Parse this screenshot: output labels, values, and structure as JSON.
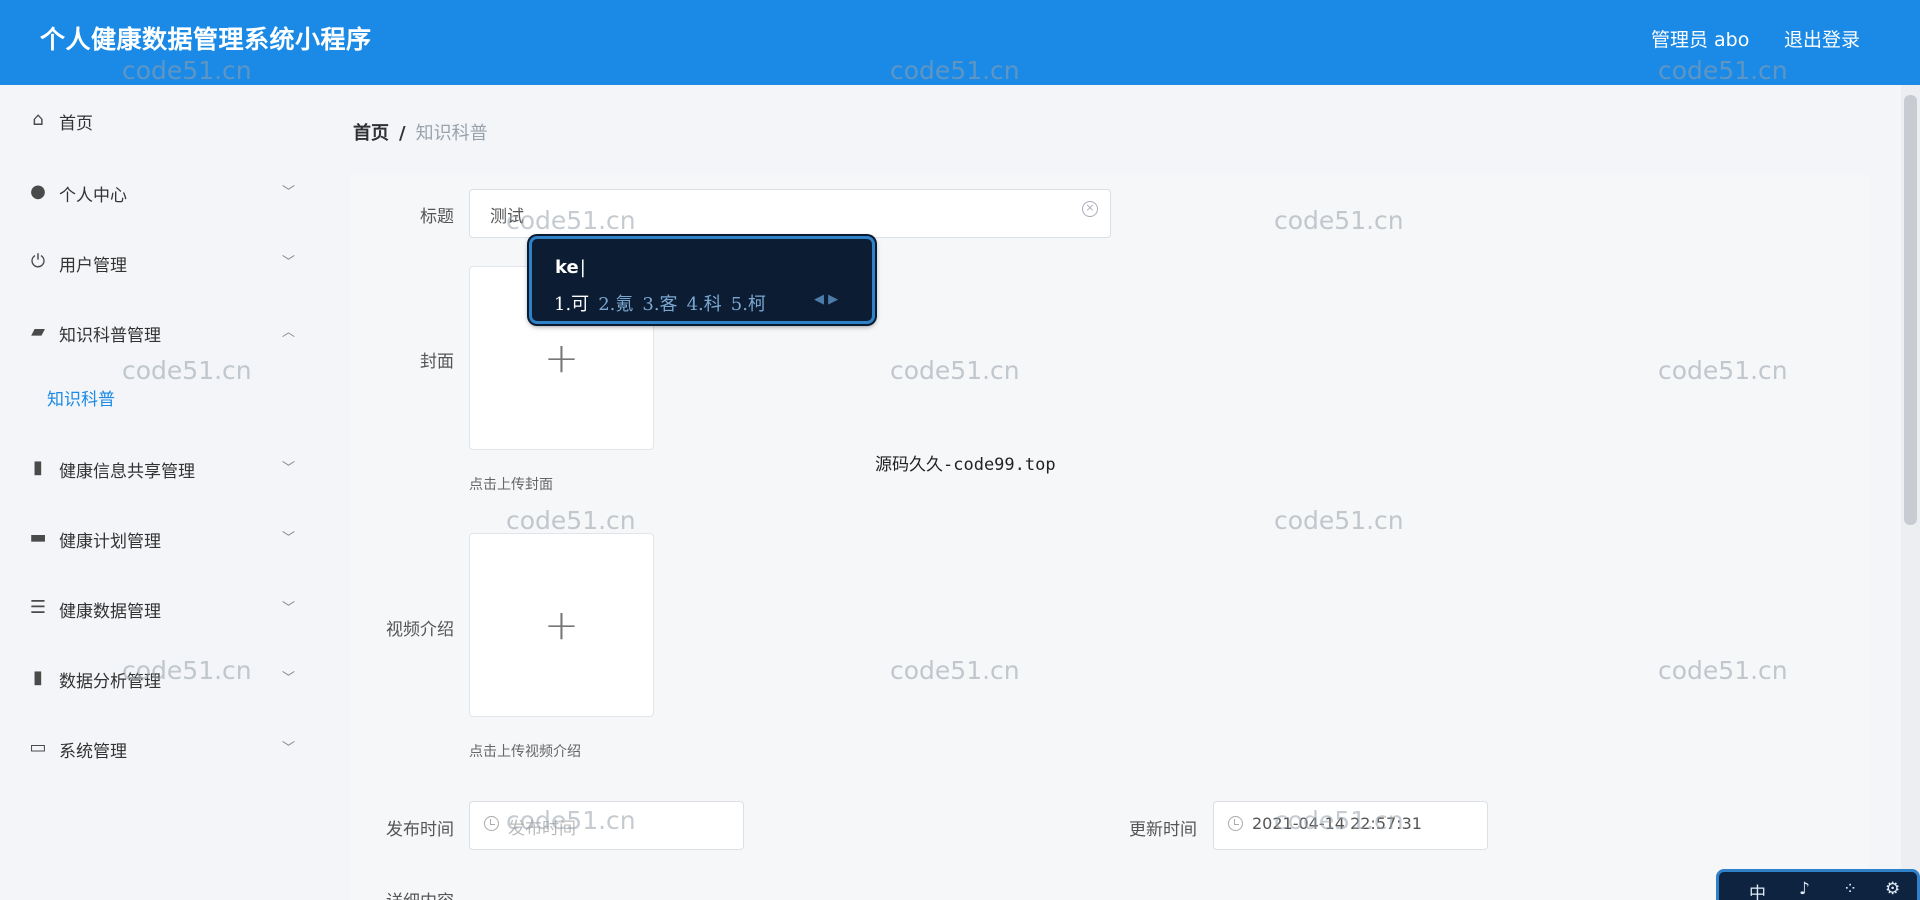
{
  "header": {
    "title": "个人健康数据管理系统小程序",
    "user": "管理员 abo",
    "logout": "退出登录",
    "color": "#1a8ae6"
  },
  "sidebar": {
    "items": [
      {
        "label": "首页",
        "icon": "home-icon",
        "glyph": "⌂"
      },
      {
        "label": "个人中心",
        "icon": "person-icon",
        "glyph": "●"
      },
      {
        "label": "用户管理",
        "icon": "power-icon",
        "glyph": "⏻"
      },
      {
        "label": "知识科普管理",
        "icon": "wallet-icon",
        "glyph": "▰"
      },
      {
        "label": "健康信息共享管理",
        "icon": "flashlight-icon",
        "glyph": "▮"
      },
      {
        "label": "健康计划管理",
        "icon": "briefcase-icon",
        "glyph": "▬"
      },
      {
        "label": "健康数据管理",
        "icon": "list-icon",
        "glyph": "☰"
      },
      {
        "label": "数据分析管理",
        "icon": "bar-chart-icon",
        "glyph": "▮"
      },
      {
        "label": "系统管理",
        "icon": "card-icon",
        "glyph": "▭"
      }
    ],
    "submenu_active": "知识科普",
    "active_color": "#1a8ae6"
  },
  "breadcrumb": {
    "home": "首页",
    "separator": "/",
    "current": "知识科普"
  },
  "form": {
    "title_label": "标题",
    "title_value": "测试",
    "cover_label": "封面",
    "cover_hint": "点击上传封面",
    "video_label": "视频介绍",
    "video_hint": "点击上传视频介绍",
    "publish_label": "发布时间",
    "publish_placeholder": "发布时间",
    "update_label": "更新时间",
    "update_value": "2021-04-14 22:57:31",
    "detail_label": "详细内容"
  },
  "ime": {
    "composition": "ke",
    "candidates": [
      "1.可",
      "2.氪",
      "3.客",
      "4.科",
      "5.柯"
    ],
    "toolbar": [
      "中",
      "♪",
      "⁘",
      "⚙"
    ]
  },
  "watermarks": {
    "text": "code51.cn",
    "center_text": "源码久久-code99.top"
  }
}
